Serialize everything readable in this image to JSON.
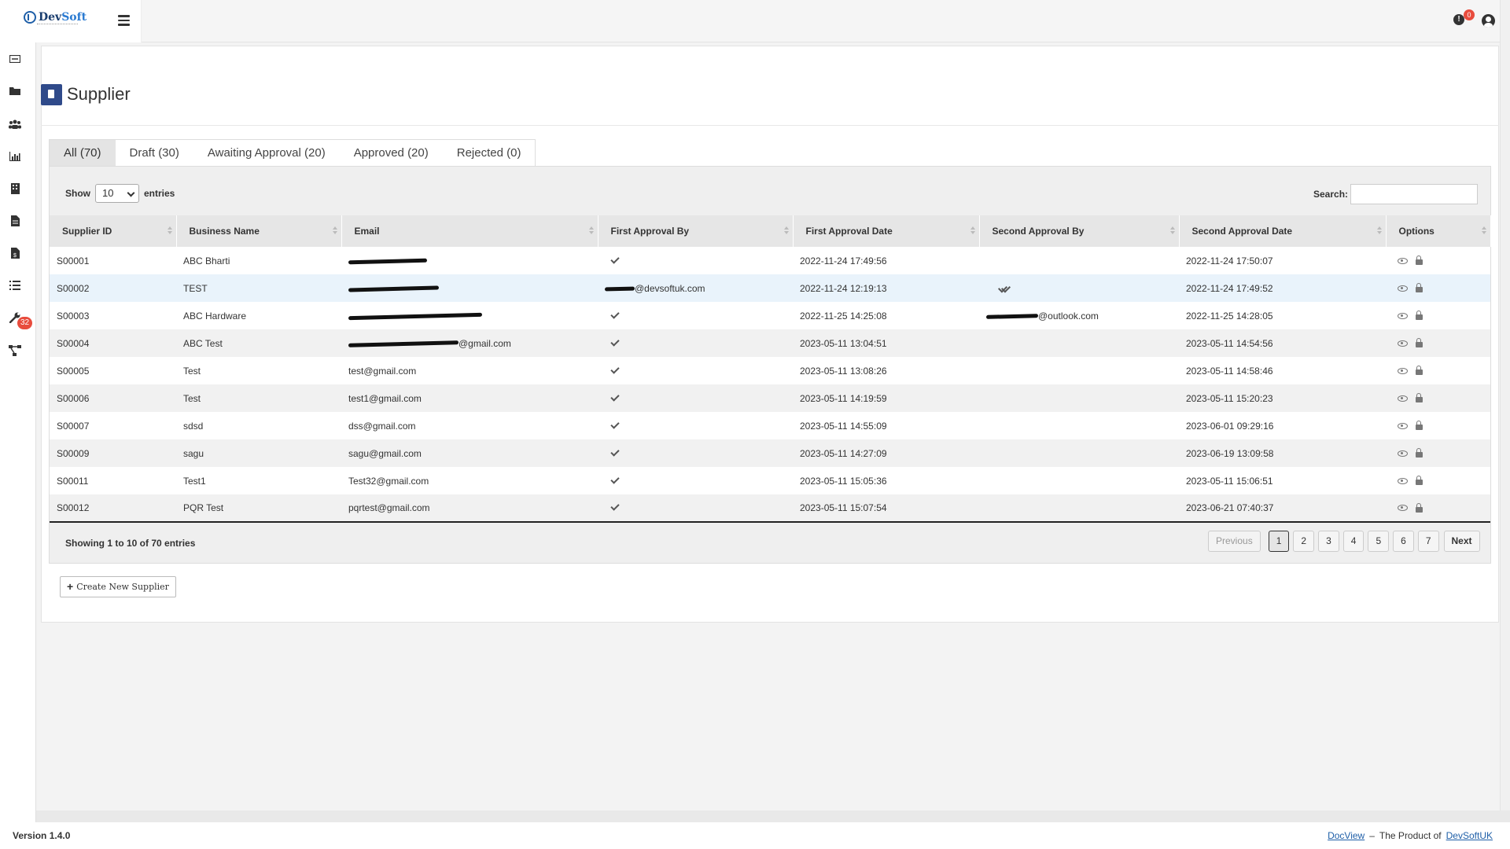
{
  "header": {
    "logo_text_dev": "Dev",
    "logo_text_soft": "Soft",
    "notification_count": "0",
    "icons": [
      "menu-icon",
      "alert-icon",
      "user-icon"
    ]
  },
  "sidebar": {
    "items": [
      {
        "name": "dashboard-icon"
      },
      {
        "name": "folder-icon"
      },
      {
        "name": "users-icon"
      },
      {
        "name": "chart-icon"
      },
      {
        "name": "building-icon"
      },
      {
        "name": "document-icon"
      },
      {
        "name": "invoice-icon"
      },
      {
        "name": "tasks-icon",
        "badge": "32"
      },
      {
        "name": "wrench-icon"
      },
      {
        "name": "workflow-icon"
      }
    ]
  },
  "page": {
    "title": "Supplier",
    "title_icon": "book-icon"
  },
  "tabs": [
    {
      "label": "All (70)",
      "active": true
    },
    {
      "label": "Draft (30)",
      "active": false
    },
    {
      "label": "Awaiting Approval (20)",
      "active": false
    },
    {
      "label": "Approved (20)",
      "active": false
    },
    {
      "label": "Rejected (0)",
      "active": false
    }
  ],
  "controls": {
    "show_label": "Show",
    "entries_value": "10",
    "entries_label": "entries",
    "search_label": "Search:",
    "search_value": ""
  },
  "table": {
    "columns": [
      "Supplier ID",
      "Business Name",
      "Email",
      "First Approval By",
      "First Approval Date",
      "Second Approval By",
      "Second Approval Date",
      "Options"
    ],
    "rows": [
      {
        "id": "S00001",
        "name": "ABC Bharti",
        "email": "",
        "email_redacted": 100,
        "first_by": "",
        "first_by_redacted": 0,
        "first_check": true,
        "first_date": "2022-11-24 17:49:56",
        "second_by": "",
        "second_by_redacted": 0,
        "second_check": false,
        "second_date": "2022-11-24 17:50:07"
      },
      {
        "id": "S00002",
        "name": "TEST",
        "email": "",
        "email_redacted": 115,
        "first_by": "@devsoftuk.com",
        "first_by_redacted": 38,
        "first_check": false,
        "first_date": "2022-11-24 12:19:13",
        "second_by": "",
        "second_by_redacted": 0,
        "second_check": false,
        "second_dblcheck": true,
        "second_date": "2022-11-24 17:49:52"
      },
      {
        "id": "S00003",
        "name": "ABC Hardware",
        "email": "",
        "email_redacted": 170,
        "first_by": "",
        "first_by_redacted": 0,
        "first_check": true,
        "first_date": "2022-11-25 14:25:08",
        "second_by": "@outlook.com",
        "second_by_redacted": 66,
        "second_check": false,
        "second_date": "2022-11-25 14:28:05"
      },
      {
        "id": "S00004",
        "name": "ABC Test",
        "email": "@gmail.com",
        "email_redacted": 140,
        "first_by": "",
        "first_by_redacted": 0,
        "first_check": true,
        "first_date": "2023-05-11 13:04:51",
        "second_by": "",
        "second_by_redacted": 0,
        "second_check": false,
        "second_date": "2023-05-11 14:54:56"
      },
      {
        "id": "S00005",
        "name": "Test",
        "email": "test@gmail.com",
        "email_redacted": 0,
        "first_by": "",
        "first_by_redacted": 0,
        "first_check": true,
        "first_date": "2023-05-11 13:08:26",
        "second_by": "",
        "second_by_redacted": 0,
        "second_check": false,
        "second_date": "2023-05-11 14:58:46"
      },
      {
        "id": "S00006",
        "name": "Test",
        "email": "test1@gmail.com",
        "email_redacted": 0,
        "first_by": "",
        "first_by_redacted": 0,
        "first_check": true,
        "first_date": "2023-05-11 14:19:59",
        "second_by": "",
        "second_by_redacted": 0,
        "second_check": false,
        "second_date": "2023-05-11 15:20:23"
      },
      {
        "id": "S00007",
        "name": "sdsd",
        "email": "dss@gmail.com",
        "email_redacted": 0,
        "first_by": "",
        "first_by_redacted": 0,
        "first_check": true,
        "first_date": "2023-05-11 14:55:09",
        "second_by": "",
        "second_by_redacted": 0,
        "second_check": false,
        "second_date": "2023-06-01 09:29:16"
      },
      {
        "id": "S00009",
        "name": "sagu",
        "email": "sagu@gmail.com",
        "email_redacted": 0,
        "first_by": "",
        "first_by_redacted": 0,
        "first_check": true,
        "first_date": "2023-05-11 14:27:09",
        "second_by": "",
        "second_by_redacted": 0,
        "second_check": false,
        "second_date": "2023-06-19 13:09:58"
      },
      {
        "id": "S00011",
        "name": "Test1",
        "email": "Test32@gmail.com",
        "email_redacted": 0,
        "first_by": "",
        "first_by_redacted": 0,
        "first_check": true,
        "first_date": "2023-05-11 15:05:36",
        "second_by": "",
        "second_by_redacted": 0,
        "second_check": false,
        "second_date": "2023-05-11 15:06:51"
      },
      {
        "id": "S00012",
        "name": "PQR Test",
        "email": "pqrtest@gmail.com",
        "email_redacted": 0,
        "first_by": "",
        "first_by_redacted": 0,
        "first_check": true,
        "first_date": "2023-05-11 15:07:54",
        "second_by": "",
        "second_by_redacted": 0,
        "second_check": false,
        "second_date": "2023-06-21 07:40:37"
      }
    ],
    "highlighted_row": 1
  },
  "pagination": {
    "info": "Showing 1 to 10 of 70 entries",
    "previous": "Previous",
    "pages": [
      "1",
      "2",
      "3",
      "4",
      "5",
      "6",
      "7"
    ],
    "active_page": "1",
    "next": "Next"
  },
  "actions": {
    "create_label": "Create New Supplier"
  },
  "footer": {
    "version": "Version 1.4.0",
    "link_docview": "DocView",
    "separator": "–",
    "product_of": "The Product of",
    "link_company": "DevSoftUK"
  }
}
